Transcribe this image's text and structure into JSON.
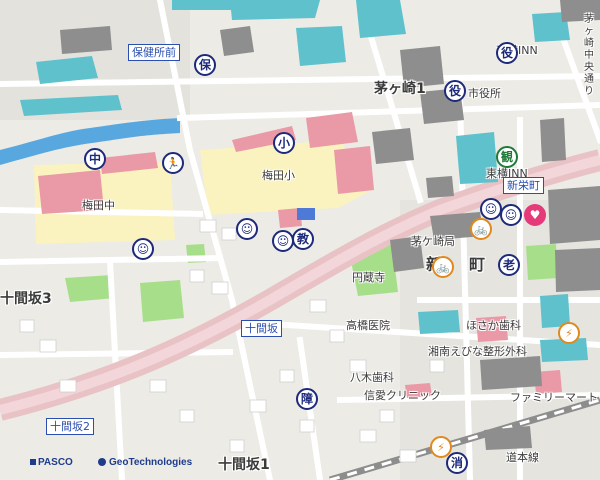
{
  "map": {
    "area_labels": {
      "chigasaki1": "茅ヶ崎1",
      "jikkanzaka3": "十間坂3",
      "jikkanzaka1": "十間坂1",
      "umeda_chu": "梅田中",
      "umeda_sho": "梅田小",
      "chigasaki_kyoku": "茅ケ崎局",
      "shinsakaecho_area": "新",
      "machi_area": "町",
      "enzoji": "円蔵寺",
      "takahashi_iin": "高橋医院",
      "hosaka_shika": "ほさか歯科",
      "yagi_shika": "八木歯科",
      "seiai_clinic": "信愛クリニック",
      "shonan_ebina": "湘南えびな整形外科",
      "family_mart": "ファミリーマート",
      "toyoko_inn_top": "東横INN",
      "toyoko_inn_mid": "東横INN",
      "shiyakusho": "市役所",
      "chuo_dori": "茅ヶ崎中央通り",
      "railway": "道本線"
    },
    "boxed_labels": {
      "hokenjo_mae": "保健所前",
      "shinsakaecho": "新栄町",
      "jikkanzaka_crossing": "十間坂",
      "jikkanzaka2": "十間坂2"
    },
    "symbols": [
      {
        "name": "health-center-icon",
        "glyph": "保",
        "style": "default"
      },
      {
        "name": "city-office-icon",
        "glyph": "役",
        "style": "default"
      },
      {
        "name": "city-office-icon-2",
        "glyph": "役",
        "style": "default"
      },
      {
        "name": "junior-high-school-icon",
        "glyph": "中",
        "style": "default"
      },
      {
        "name": "sports-facility-icon",
        "glyph": "🏃",
        "style": "default"
      },
      {
        "name": "elementary-school-icon",
        "glyph": "小",
        "style": "default"
      },
      {
        "name": "tourist-info-icon",
        "glyph": "観",
        "style": "green"
      },
      {
        "name": "nursery-icon",
        "glyph": "☺",
        "style": "default"
      },
      {
        "name": "nursery-icon-2",
        "glyph": "☺",
        "style": "default"
      },
      {
        "name": "nursery-icon-3",
        "glyph": "☺",
        "style": "default"
      },
      {
        "name": "nursery-icon-4",
        "glyph": "☺",
        "style": "default"
      },
      {
        "name": "nursery-icon-5",
        "glyph": "☺",
        "style": "default"
      },
      {
        "name": "education-icon",
        "glyph": "教",
        "style": "default"
      },
      {
        "name": "bicycle-parking-icon",
        "glyph": "🚲",
        "style": "orange"
      },
      {
        "name": "bicycle-parking-icon-2",
        "glyph": "🚲",
        "style": "orange"
      },
      {
        "name": "aed-icon",
        "glyph": "♥",
        "style": "pink"
      },
      {
        "name": "elderly-facility-icon",
        "glyph": "老",
        "style": "default"
      },
      {
        "name": "welfare-icon",
        "glyph": "障",
        "style": "default"
      },
      {
        "name": "fire-station-icon",
        "glyph": "消",
        "style": "default"
      },
      {
        "name": "evacuation-icon",
        "glyph": "⚡",
        "style": "orange"
      },
      {
        "name": "evacuation-icon-2",
        "glyph": "⚡",
        "style": "orange"
      }
    ],
    "credits": {
      "pasco": "PASCO",
      "geotech": "GeoTechnologies"
    },
    "colors": {
      "background": "#ecebe6",
      "main_road": "#e9c2c6",
      "main_road_core": "#f3d6d9",
      "river": "#58a8df",
      "school": "#faf3bf",
      "green": "#a7de8a",
      "building_teal": "#5ec1cc",
      "building_pink": "#ea9aa6",
      "symbol_navy": "#1d2a7a",
      "label_blue": "#2a4fb0"
    }
  }
}
